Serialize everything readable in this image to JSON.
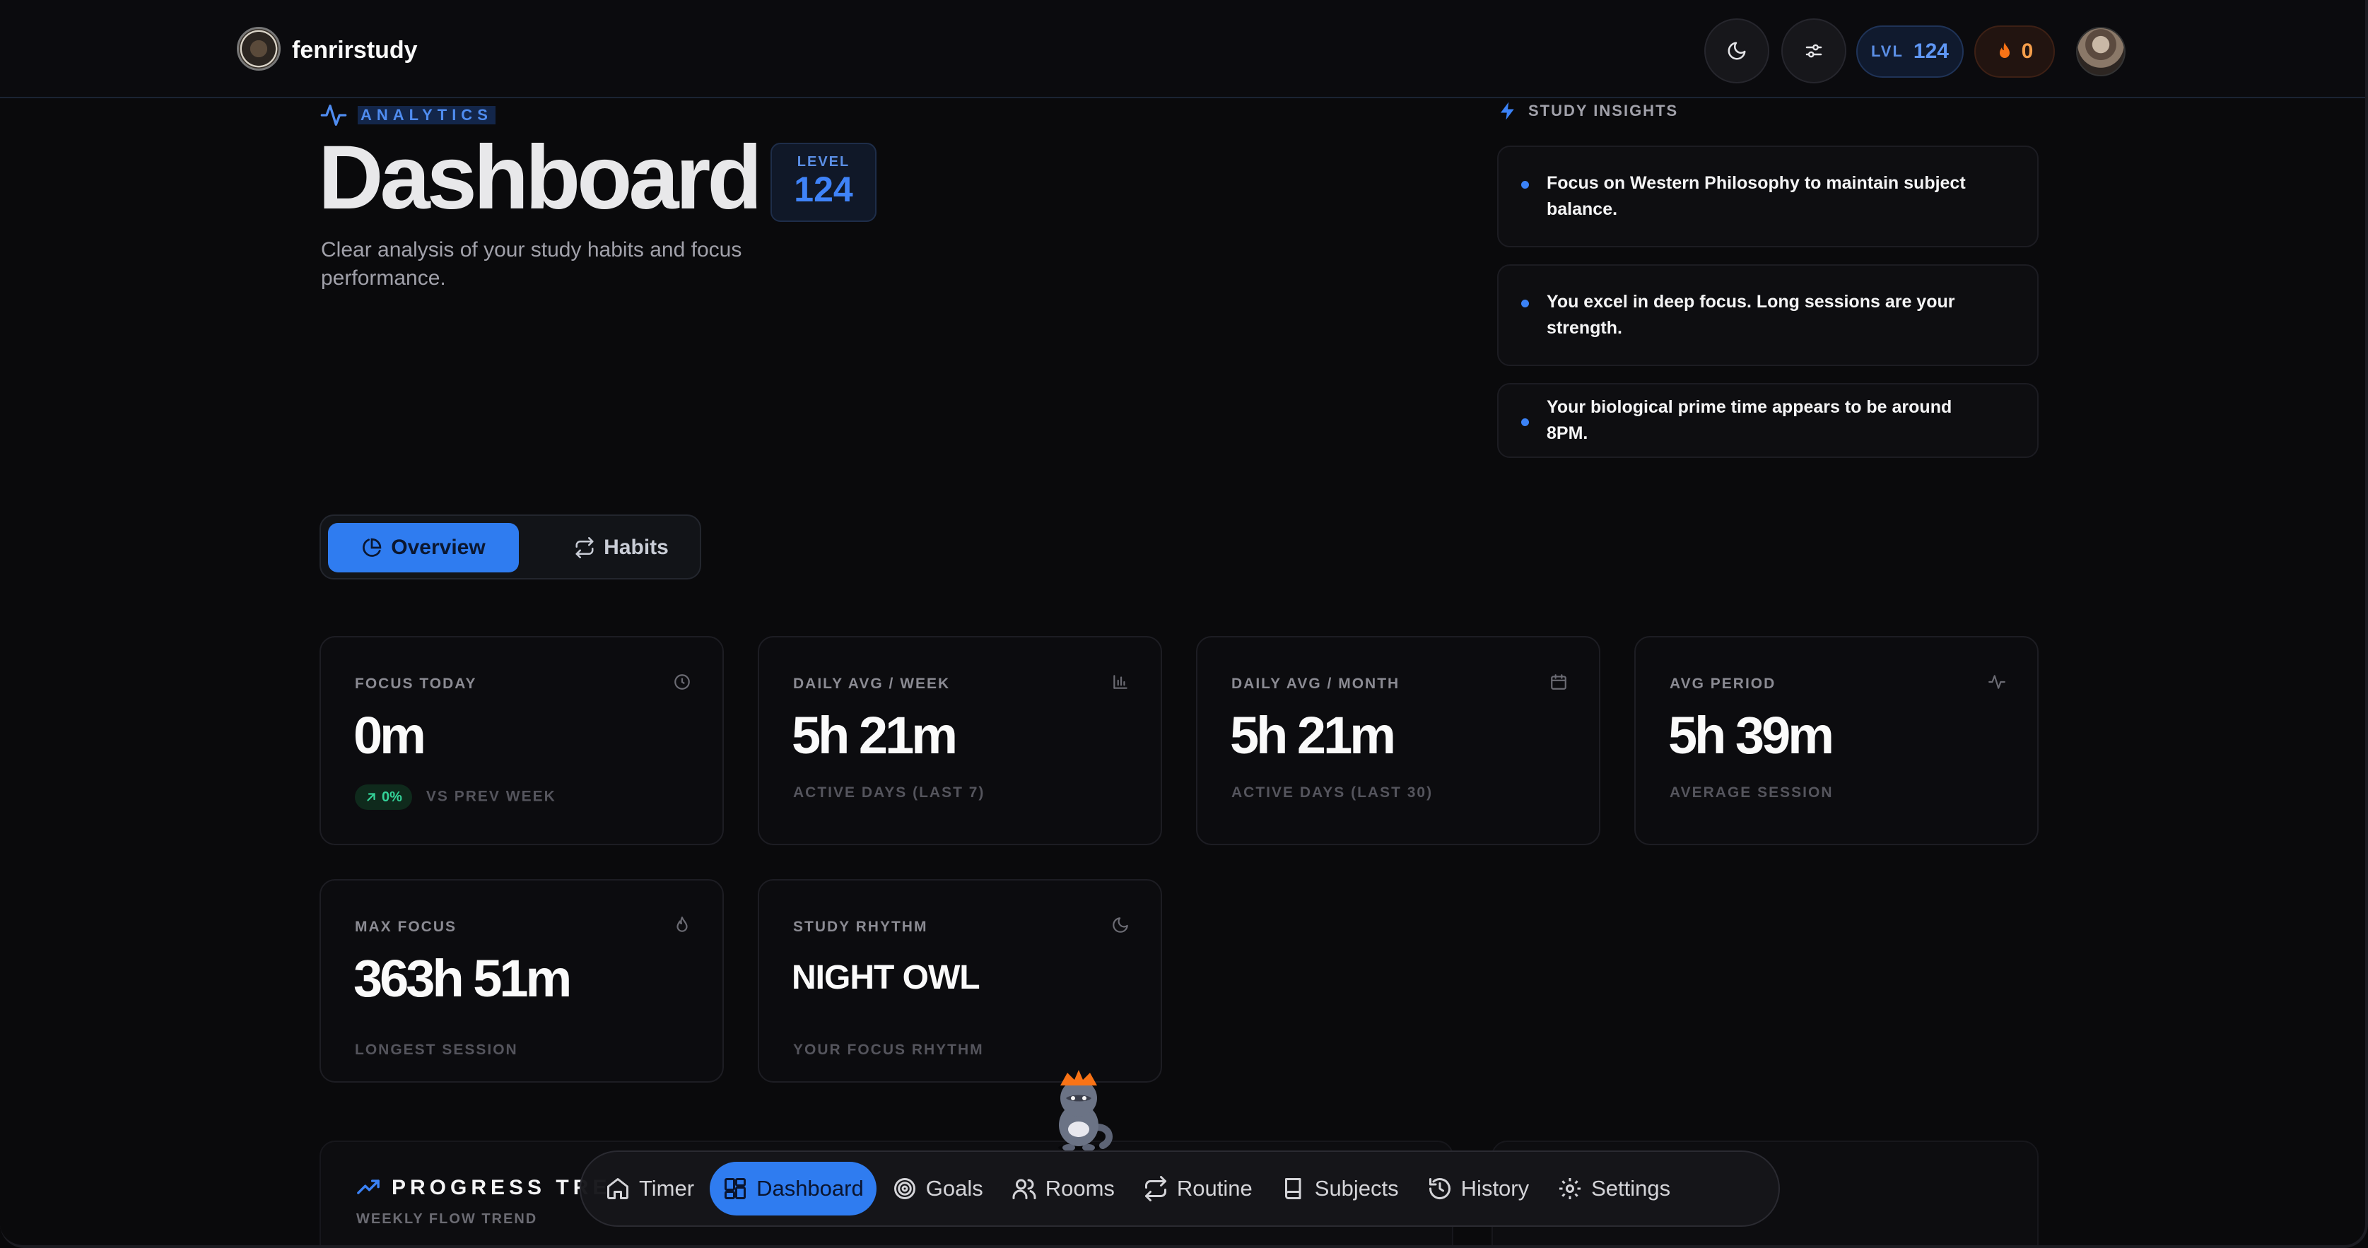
{
  "header": {
    "brand": "fenrirstudy",
    "level_label": "LVL",
    "level_value": "124",
    "streak_value": "0",
    "icons": [
      "moon-icon",
      "sliders-icon",
      "flame-icon"
    ]
  },
  "hero": {
    "eyebrow": "ANALYTICS",
    "title": "Dashboard",
    "level_label": "LEVEL",
    "level_value": "124",
    "subtitle": "Clear analysis of your study habits and focus performance."
  },
  "insights": {
    "title": "STUDY INSIGHTS",
    "items": [
      "Focus on Western Philosophy to maintain subject balance.",
      "You excel in deep focus. Long sessions are your strength.",
      "Your biological prime time appears to be around 8PM."
    ]
  },
  "tabs": [
    {
      "label": "Overview",
      "active": true
    },
    {
      "label": "Habits",
      "active": false
    }
  ],
  "stats": [
    {
      "label": "FOCUS TODAY",
      "value": "0m",
      "badge": "0%",
      "foot": "VS PREV WEEK",
      "icon": "clock-icon"
    },
    {
      "label": "DAILY AVG / WEEK",
      "value": "5h 21m",
      "foot": "ACTIVE DAYS (LAST 7)",
      "icon": "bar-chart-icon"
    },
    {
      "label": "DAILY AVG / MONTH",
      "value": "5h 21m",
      "foot": "ACTIVE DAYS (LAST 30)",
      "icon": "calendar-icon"
    },
    {
      "label": "AVG PERIOD",
      "value": "5h 39m",
      "foot": "AVERAGE SESSION",
      "icon": "activity-icon"
    },
    {
      "label": "MAX FOCUS",
      "value": "363h 51m",
      "foot": "LONGEST SESSION",
      "icon": "flame-icon"
    },
    {
      "label": "STUDY RHYTHM",
      "value": "NIGHT OWL",
      "foot": "YOUR FOCUS RHYTHM",
      "icon": "moon-icon"
    }
  ],
  "progress": {
    "title": "PROGRESS TRE",
    "subtitle": "WEEKLY FLOW TREND"
  },
  "nav": [
    {
      "label": "Timer",
      "icon": "home-icon"
    },
    {
      "label": "Dashboard",
      "icon": "grid-icon",
      "active": true
    },
    {
      "label": "Goals",
      "icon": "target-icon"
    },
    {
      "label": "Rooms",
      "icon": "users-icon"
    },
    {
      "label": "Routine",
      "icon": "repeat-icon"
    },
    {
      "label": "Subjects",
      "icon": "book-icon"
    },
    {
      "label": "History",
      "icon": "history-icon"
    },
    {
      "label": "Settings",
      "icon": "gear-icon"
    }
  ],
  "colors": {
    "accent": "#2f7cf0",
    "background": "#09090b",
    "streak": "#f59e4b",
    "positive": "#34d399"
  }
}
